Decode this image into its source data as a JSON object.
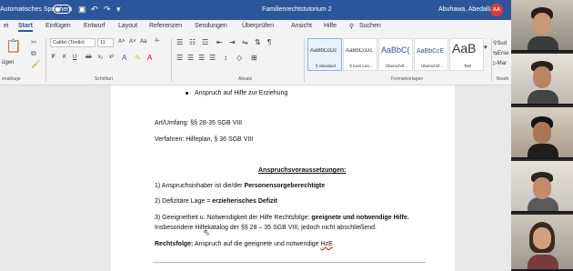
{
  "titlebar": {
    "autosave_label": "Automatisches Speichern",
    "toggle_state": "Aus",
    "quick_icons": [
      "save-icon",
      "undo-icon",
      "redo-icon",
      "customize-icon"
    ],
    "document_title": "Familienrechtstutorium 2",
    "user_name": "Abuhawa, Abedallah",
    "user_initials": "AA",
    "accent": "#2b579a"
  },
  "tabs": [
    "ei",
    "Start",
    "Einfügen",
    "Entwurf",
    "Layout",
    "Referenzen",
    "Sendungen",
    "Überprüfen",
    "Ansicht",
    "Hilfe"
  ],
  "search_label": "Suchen",
  "ribbon": {
    "clipboard_paste": "ügen",
    "clipboard_group": "enablage",
    "font_name": "Calibri (Textkö",
    "font_size": "11",
    "font_group": "Schriftart",
    "paragraph_group": "Absatz",
    "styles_group": "Formatvorlagen",
    "editor_group": "Bearb",
    "font_buttons": {
      "grow": "A˄",
      "shrink": "A˅",
      "case": "Aa",
      "bold": "F",
      "italic": "K",
      "underline": "U",
      "strike": "ab",
      "subscript": "x₂",
      "superscript": "x²"
    },
    "styles": [
      {
        "preview": "AaBbCcDc",
        "name": "¶ Standard"
      },
      {
        "preview": "AaBbCcDc",
        "name": "¶ Kein Lee..."
      },
      {
        "preview": "AaBbC(",
        "name": "Überschrif..."
      },
      {
        "preview": "AaBbCcE",
        "name": "Überschrif..."
      },
      {
        "preview": "AaB",
        "name": "Titel"
      }
    ],
    "side_search": "Sud",
    "side_replace": "Erse",
    "side_mark": "Mar"
  },
  "document": {
    "bullet_item": "Anspruch auf Hilfe zur Erziehung",
    "art_umfang": "Art/Umfang: §§ 28-35 SGB VIII",
    "verfahren": "Verfahren: Hilfeplan, § 36 SGB VIII",
    "heading": "Anspruchsvoraussetzungen:",
    "item1_prefix": "1) Anspruchsinhaber ist die/der ",
    "item1_bold": "Personensorgeberechtigte",
    "item2_prefix": "2) Defizitäre Lage = ",
    "item2_bold": "erzieherisches Defizit",
    "item3_prefix": "3) Geeignetheit u. Notwendigkeit der Hilfe Rechtsfolge: ",
    "item3_bold": "geeignete und notwendige Hilfe.",
    "item3_line2": "Insbesondere Hilfekatalog der §§ 28 – 35 SGB VIII, jedoch nicht abschließend.",
    "rechtsfolge_label": "Rechtsfolge:",
    "rechtsfolge_text": " Anspruch auf die geeignete und notwendige ",
    "rechtsfolge_abbr": "HzE"
  },
  "participants": [
    "participant-1",
    "participant-2",
    "participant-3",
    "participant-4",
    "participant-5"
  ]
}
